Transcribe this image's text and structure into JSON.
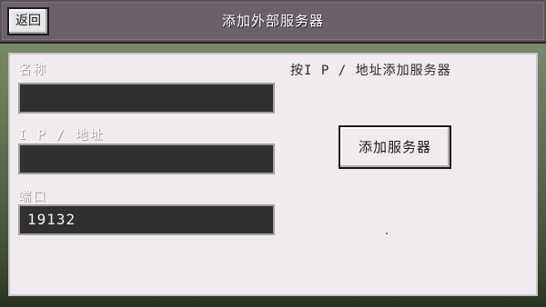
{
  "header": {
    "back_label": "返回",
    "title": "添加外部服务器"
  },
  "form": {
    "name_label": "名称",
    "name_value": "",
    "address_label": "I P / 地址",
    "address_value": "",
    "port_label": "端口",
    "port_value": "19132"
  },
  "side": {
    "hint": "按I P / 地址添加服务器",
    "add_button_label": "添加服务器"
  }
}
